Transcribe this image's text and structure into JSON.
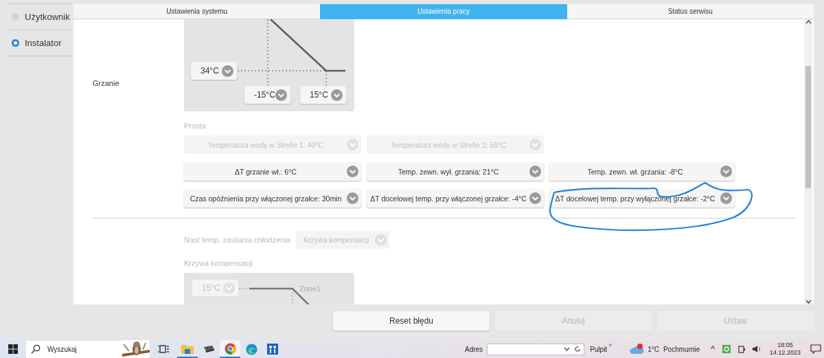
{
  "sidebar": {
    "items": [
      {
        "label": "Użytkownik",
        "selected": false
      },
      {
        "label": "Instalator",
        "selected": true
      }
    ]
  },
  "tabs": [
    {
      "label": "Ustawienia systemu",
      "selected": false
    },
    {
      "label": "Ustawienia pracy",
      "selected": true
    },
    {
      "label": "Status serwisu",
      "selected": false
    }
  ],
  "heating": {
    "label": "Grzanie",
    "curve_chips": [
      {
        "value": "34°C",
        "disabled": false
      },
      {
        "value": "-15°C",
        "disabled": false
      },
      {
        "value": "15°C",
        "disabled": false
      }
    ],
    "mode_label": "Prosta",
    "rows": [
      [
        {
          "value": "Temperatura wody w Strefie 1: 40°C",
          "disabled": true
        },
        {
          "value": "Temperatura wody w Strefie 2: 55°C",
          "disabled": true
        }
      ],
      [
        {
          "value": "ΔT grzanie wł.: 6°C",
          "disabled": false
        },
        {
          "value": "Temp. zewn. wył. grzania: 21°C",
          "disabled": false
        },
        {
          "value": "Temp. zewn. wł. grzania: -8°C",
          "disabled": false
        }
      ],
      [
        {
          "value": "Czas opóźnienia przy włączonej grzałce: 30min",
          "disabled": false
        },
        {
          "value": "ΔT docelowej temp. przy włączonej grzałce: -4°C",
          "disabled": false
        },
        {
          "value": "ΔT docelowej temp. przy wyłączonej grzałce: -2°C",
          "disabled": false
        }
      ]
    ]
  },
  "cooling": {
    "label": "Nast temp. zasilania chłodzenia",
    "select": {
      "value": "Krzywa kompensacji",
      "disabled": true
    },
    "curve_label": "Krzywa kompensacji",
    "curve_chip": {
      "value": "15°C",
      "disabled": true
    },
    "zone": "Zone1"
  },
  "buttons": [
    {
      "label": "Reset błędu",
      "disabled": false
    },
    {
      "label": "Anuluj",
      "disabled": true
    },
    {
      "label": "Ustaw",
      "disabled": true
    }
  ],
  "taskbar": {
    "search": {
      "placeholder": "Wyszukaj"
    },
    "address_label": "Adres",
    "toolbar": "Pulpit",
    "more": "»",
    "weather": {
      "temp": "1°C",
      "condition": "Pochmurnie"
    },
    "tray_arrow": "^",
    "time": "18:05",
    "date": "14.12.2023"
  }
}
